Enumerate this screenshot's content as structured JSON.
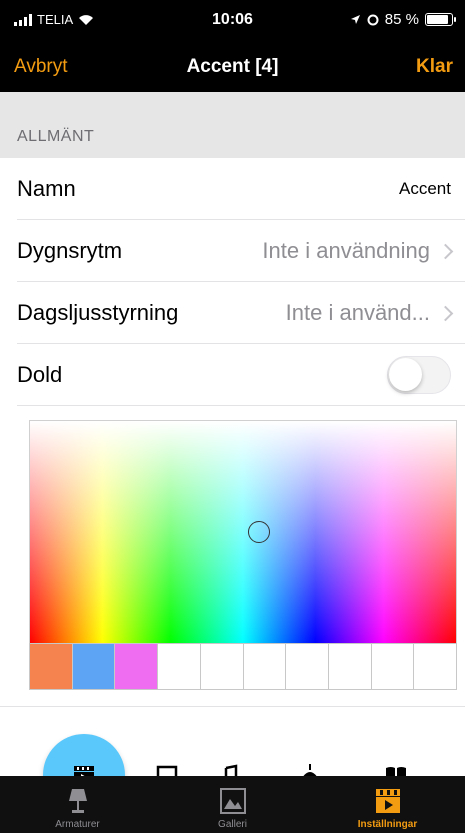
{
  "status_bar": {
    "carrier": "TELIA",
    "time": "10:06",
    "battery": "85 %"
  },
  "nav": {
    "cancel": "Avbryt",
    "title": "Accent [4]",
    "done": "Klar"
  },
  "section": {
    "header": "ALLMÄNT"
  },
  "rows": [
    {
      "label": "Namn",
      "value": "Accent"
    },
    {
      "label": "Dygnsrytm",
      "value": "Inte i användning"
    },
    {
      "label": "Dagsljusstyrning",
      "value": "Inte i använd..."
    },
    {
      "label": "Dold",
      "toggle": false
    }
  ],
  "swatches": [
    "#f4834f",
    "#5ea4f5",
    "#ef6df1",
    "#ffffff",
    "#ffffff",
    "#ffffff",
    "#ffffff",
    "#ffffff",
    "#ffffff",
    "#ffffff"
  ],
  "help": {
    "label": "?"
  },
  "tabs": [
    {
      "label": "Armaturer",
      "icon": "lamp-icon"
    },
    {
      "label": "Galleri",
      "icon": "gallery-icon"
    },
    {
      "label": "Inställningar",
      "icon": "clapperboard-icon",
      "active": true
    }
  ],
  "colors": {
    "accent": "#f39c12",
    "active_scene": "#5ac8fa"
  }
}
